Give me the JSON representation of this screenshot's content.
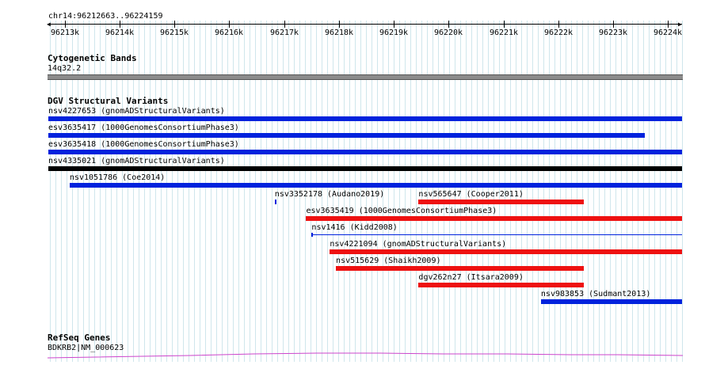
{
  "region": "chr14:96212663..96224159",
  "ruler": {
    "ticks": [
      "96213k",
      "96214k",
      "96215k",
      "96216k",
      "96217k",
      "96218k",
      "96219k",
      "96220k",
      "96221k",
      "96222k",
      "96223k",
      "96224k"
    ]
  },
  "tracks": {
    "cytobands": {
      "title": "Cytogenetic Bands",
      "band_label": "14q32.2"
    },
    "dgv": {
      "title": "DGV Structural Variants",
      "colors": {
        "blue": "#0022dd",
        "red": "#ee1111",
        "black": "#000000"
      },
      "features": [
        {
          "label": "nsv4227653 (gnomADStructuralVariants)",
          "start": 96212663,
          "end": 96224159,
          "color": "blue"
        },
        {
          "label": "esv3635417 (1000GenomesConsortiumPhase3)",
          "start": 96212663,
          "end": 96223480,
          "color": "blue"
        },
        {
          "label": "esv3635418 (1000GenomesConsortiumPhase3)",
          "start": 96212663,
          "end": 96224159,
          "color": "blue"
        },
        {
          "label": "nsv4335021 (gnomADStructuralVariants)",
          "start": 96212663,
          "end": 96224159,
          "color": "black"
        },
        {
          "label": "nsv1051786 (Coe2014)",
          "start": 96213050,
          "end": 96224159,
          "color": "blue"
        },
        {
          "label": "nsv3352178 (Audano2019)",
          "start": 96216770,
          "end": 96216800,
          "color": "blue"
        },
        {
          "label": "nsv565647 (Cooper2011)",
          "start": 96219380,
          "end": 96222380,
          "color": "red"
        },
        {
          "label": "esv3635419 (1000GenomesConsortiumPhase3)",
          "start": 96217340,
          "end": 96224159,
          "color": "red"
        },
        {
          "label": "nsv1416 (Kidd2008)",
          "start": 96217440,
          "end": 96224159,
          "color": "blue",
          "thin": true
        },
        {
          "label": "nsv4221094 (gnomADStructuralVariants)",
          "start": 96217770,
          "end": 96224159,
          "color": "red"
        },
        {
          "label": "nsv515629 (Shaikh2009)",
          "start": 96217880,
          "end": 96222380,
          "color": "red"
        },
        {
          "label": "dgv262n27 (Itsara2009)",
          "start": 96219380,
          "end": 96222380,
          "color": "red"
        },
        {
          "label": "nsv983853 (Sudmant2013)",
          "start": 96221600,
          "end": 96224159,
          "color": "blue"
        }
      ]
    },
    "refseq": {
      "title": "RefSeq Genes",
      "gene_label": "BDKRB2|NM_000623",
      "color": "#cc44cc"
    }
  }
}
